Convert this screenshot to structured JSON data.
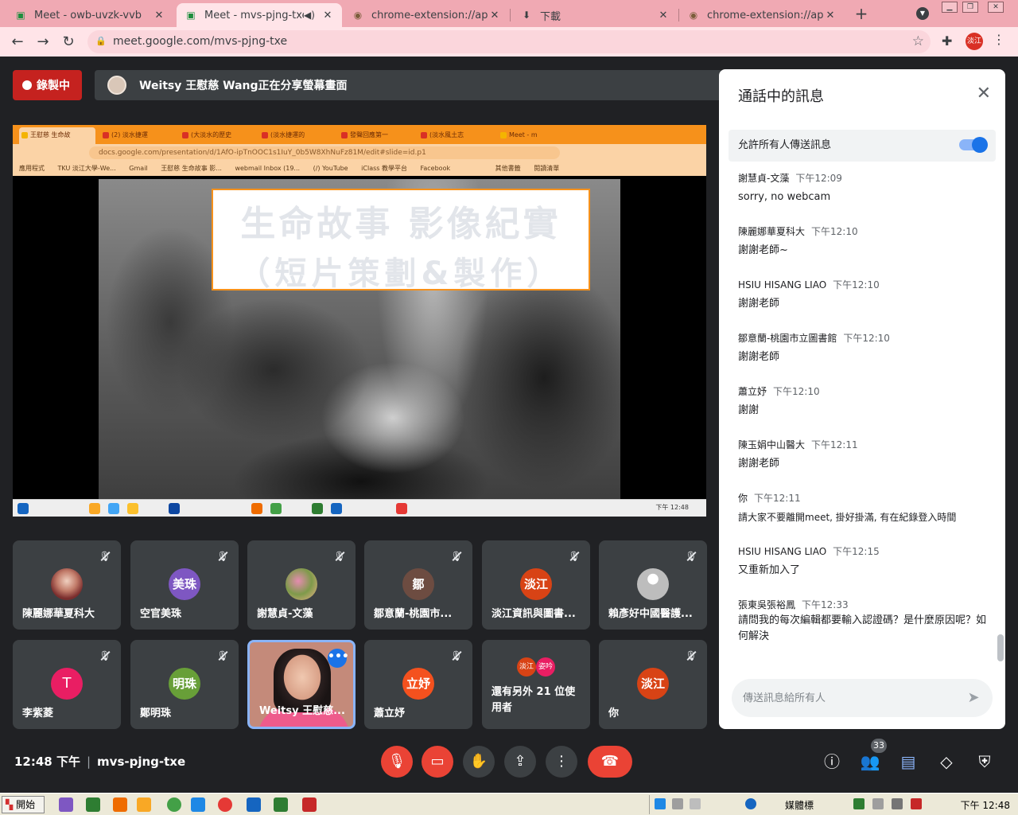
{
  "browser": {
    "tabs": [
      {
        "title": "Meet - owb-uvzk-vvb",
        "icon": "meet-icon"
      },
      {
        "title": "Meet - mvs-pjng-txe",
        "icon": "meet-icon",
        "active": true
      },
      {
        "title": "chrome-extension://appc",
        "icon": "extension-owl-icon"
      },
      {
        "title": "下載",
        "icon": "download-icon"
      },
      {
        "title": "chrome-extension://appc",
        "icon": "extension-owl-icon"
      }
    ],
    "new_tab": "+",
    "url": "meet.google.com/mvs-pjng-txe",
    "profile_label": "淡江"
  },
  "meet": {
    "recording_label": "錄製中",
    "presenting_text": "Weitsy 王慰慈 Wang正在分享螢幕畫面",
    "shared_screen": {
      "tabs": [
        "王慰慈 生命故",
        "(2) 淡水捷運",
        "(大淡水的歷史",
        "(淡水捷運的",
        "發聲回應第一",
        "(淡水風土志",
        "Meet - m"
      ],
      "url": "docs.google.com/presentation/d/1AfO-ipTnOOC1s1IuY_0b5W8XhNuFz81M/edit#slide=id.p1",
      "bookmarks": [
        "應用程式",
        "TKU 淡江大學-We...",
        "Gmail",
        "王慰慈 生命故事 影...",
        "webmail Inbox (19...",
        "(/) YouTube",
        "iClass 教學平台",
        "Facebook",
        "其他書籤",
        "閱讀清單"
      ],
      "slide_title_line1": "生命故事 影像紀實",
      "slide_title_line2": "（短片策劃&製作）",
      "taskbar_clock": "下午 12:48"
    },
    "participants": [
      {
        "name": "陳麗娜華夏科大",
        "avatar": "photo",
        "color": "#8c3f3f"
      },
      {
        "name": "空官美珠",
        "avatar": "美珠",
        "color": "#7e57c2"
      },
      {
        "name": "謝慧貞-文藻",
        "avatar": "photo",
        "color": "#b36c8c"
      },
      {
        "name": "鄒意蘭-桃園市...",
        "avatar": "鄒",
        "color": "#6d4c41"
      },
      {
        "name": "淡江資訊與圖書...",
        "avatar": "淡江",
        "color": "#d84315"
      },
      {
        "name": "賴彥好中國醫護...",
        "avatar": "person",
        "color": "#bdbdbd"
      },
      {
        "name": "李紫菱",
        "avatar": "T",
        "color": "#e91e63"
      },
      {
        "name": "鄭明珠",
        "avatar": "明珠",
        "color": "#689f38"
      },
      {
        "name": "Weitsy 王慰慈...",
        "avatar": "video",
        "color": "#ee5b8c"
      },
      {
        "name": "蕭立妤",
        "avatar": "立妤",
        "color": "#f4511e"
      },
      {
        "name": "還有另外 21 位使用者",
        "avatar": "group",
        "mini": [
          "淡江",
          "姿吟"
        ],
        "color": "#e64a19"
      },
      {
        "name": "你",
        "avatar": "淡江",
        "color": "#d84315"
      }
    ],
    "time": "12:48 下午",
    "meeting_code": "mvs-pjng-txe",
    "people_count": "33"
  },
  "chat": {
    "title": "通話中的訊息",
    "allow_label": "允許所有人傳送訊息",
    "messages": [
      {
        "sender": "謝慧貞-文藻",
        "time": "下午12:09",
        "text": "sorry, no webcam"
      },
      {
        "sender": "陳麗娜華夏科大",
        "time": "下午12:10",
        "text": "謝謝老師~"
      },
      {
        "sender": "HSIU HISANG LIAO",
        "time": "下午12:10",
        "text": "謝謝老師"
      },
      {
        "sender": "鄒意蘭-桃園市立圖書館",
        "time": "下午12:10",
        "text": "謝謝老師"
      },
      {
        "sender": "蕭立妤",
        "time": "下午12:10",
        "text": "謝謝"
      },
      {
        "sender": "陳玉娟中山醫大",
        "time": "下午12:11",
        "text": "謝謝老師"
      },
      {
        "sender": "你",
        "time": "下午12:11",
        "text": "請大家不要離開meet, 掛好掛滿, 有在紀錄登入時間"
      },
      {
        "sender": "HSIU HISANG LIAO",
        "time": "下午12:15",
        "text": "又重新加入了"
      },
      {
        "sender": "張東吳張裕鳳",
        "time": "下午12:33",
        "text": "請問我的每次編輯都要輸入認證碼？是什麼原因呢？如何解決"
      }
    ],
    "input_placeholder": "傳送訊息給所有人"
  },
  "taskbar": {
    "start_label": "開始",
    "ime_label": "媒體標",
    "clock": "下午 12:48"
  }
}
